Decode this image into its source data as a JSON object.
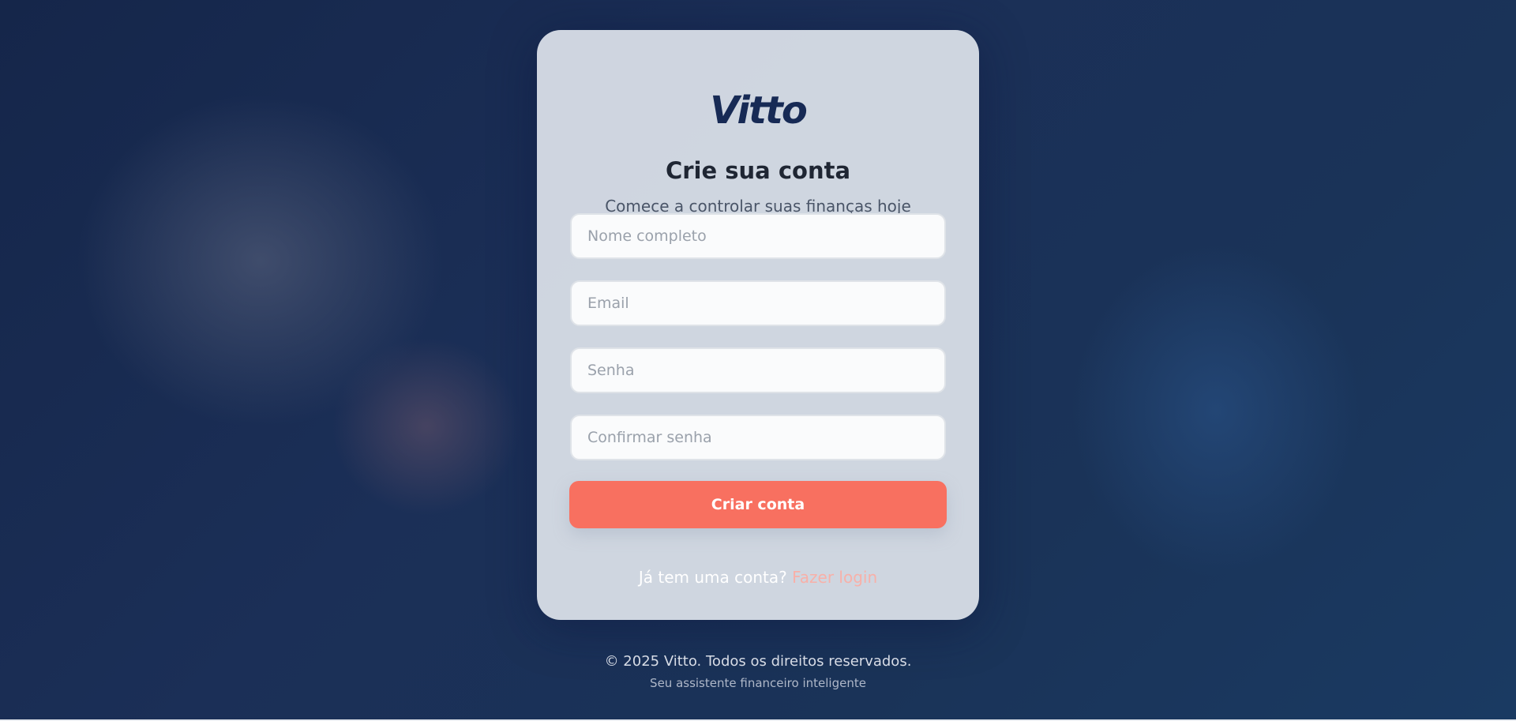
{
  "brand": {
    "logo_text": "Vitto"
  },
  "card": {
    "title": "Crie sua conta",
    "subtitle": "Comece a controlar suas finanças hoje"
  },
  "form": {
    "name_placeholder": "Nome completo",
    "name_value": "",
    "email_placeholder": "Email",
    "email_value": "",
    "password_placeholder": "Senha",
    "password_value": "",
    "confirm_placeholder": "Confirmar senha",
    "confirm_value": "",
    "submit_label": "Criar conta"
  },
  "login": {
    "prompt": "Já tem uma conta?",
    "link_label": "Fazer login"
  },
  "footer": {
    "copyright": "© 2025 Vitto. Todos os direitos reservados.",
    "tagline": "Seu assistente financeiro inteligente"
  },
  "colors": {
    "background": "#1a2c50",
    "card": "#d6dde6",
    "accent": "#f87060",
    "brand": "#172a55",
    "link": "#f8b0a8"
  }
}
